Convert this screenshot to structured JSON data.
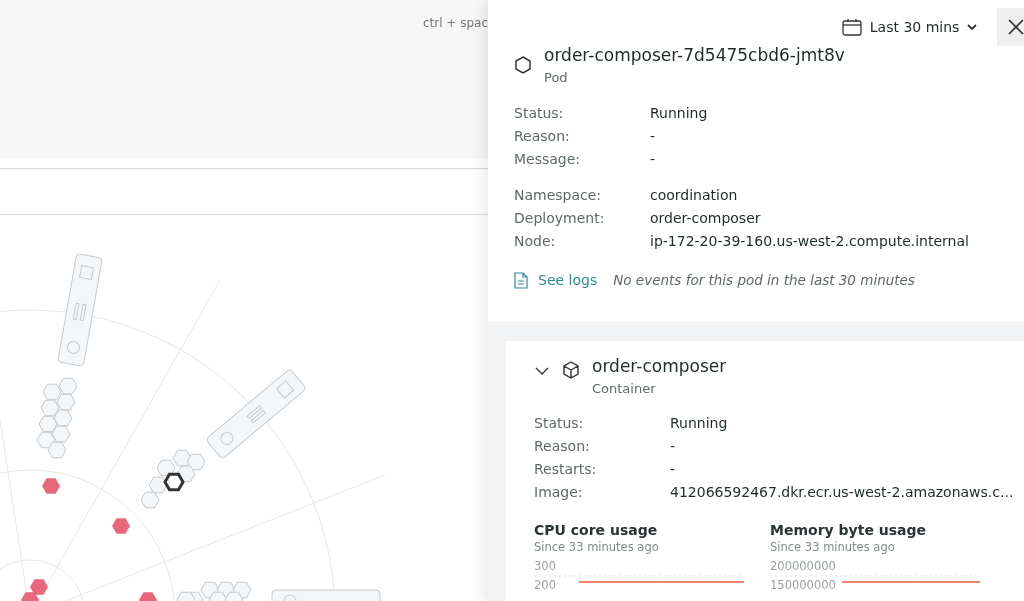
{
  "topbar": {
    "shortcut_hint": "ctrl + spac"
  },
  "panel": {
    "time_range": "Last 30 mins",
    "pod": {
      "name": "order-composer-7d5475cbd6-jmt8v",
      "kind": "Pod",
      "status_fields": [
        {
          "label": "Status:",
          "value": "Running"
        },
        {
          "label": "Reason:",
          "value": "-"
        },
        {
          "label": "Message:",
          "value": "-"
        }
      ],
      "info_fields": [
        {
          "label": "Namespace:",
          "value": "coordination"
        },
        {
          "label": "Deployment:",
          "value": "order-composer"
        },
        {
          "label": "Node:",
          "value": "ip-172-20-39-160.us-west-2.compute.internal"
        }
      ],
      "logs_link": "See logs",
      "events_note": "No events for this pod in the last 30 minutes"
    },
    "container": {
      "name": "order-composer",
      "kind": "Container",
      "expanded": true,
      "fields": [
        {
          "label": "Status:",
          "value": "Running"
        },
        {
          "label": "Reason:",
          "value": "-"
        },
        {
          "label": "Restarts:",
          "value": "-"
        },
        {
          "label": "Image:",
          "value": "412066592467.dkr.ecr.us-west-2.amazonaws.c..."
        }
      ],
      "charts": [
        {
          "title": "CPU core usage",
          "subtitle": "Since 33 minutes ago",
          "axis_labels": [
            "300",
            "200"
          ]
        },
        {
          "title": "Memory byte usage",
          "subtitle": "Since 33 minutes ago",
          "axis_labels": [
            "200000000",
            "150000000"
          ]
        }
      ]
    }
  }
}
